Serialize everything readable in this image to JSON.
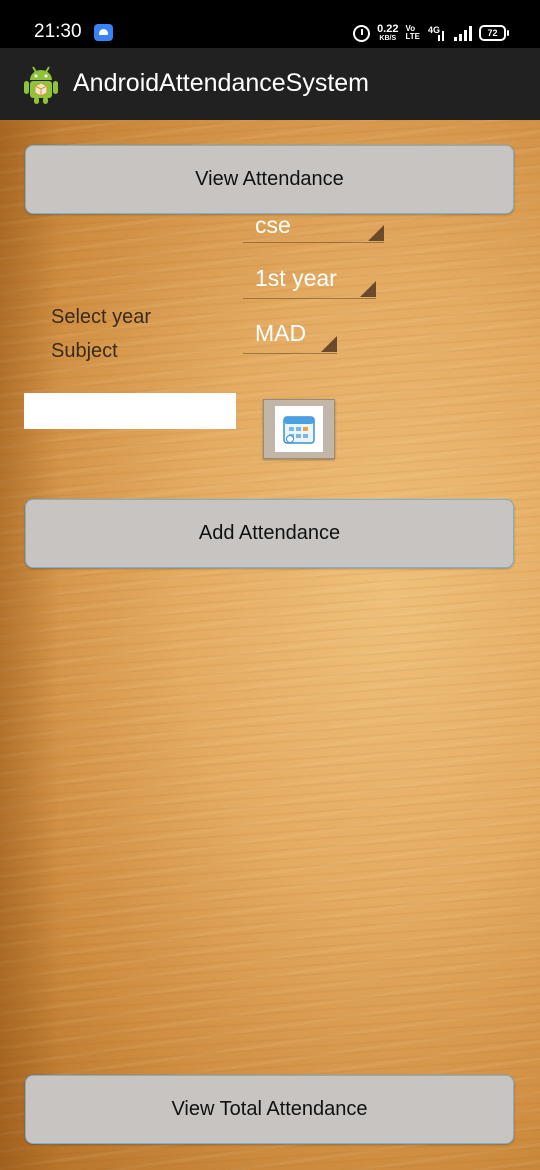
{
  "status_bar": {
    "time": "21:30",
    "net_speed_value": "0.22",
    "net_speed_unit": "KB/S",
    "volte_top": "Vo",
    "volte_bottom": "LTE",
    "network": "4G",
    "battery": "72"
  },
  "action_bar": {
    "title": "AndroidAttendanceSystem",
    "logo_icon": "android-robot-icon"
  },
  "main": {
    "view_attendance_label": "View Attendance",
    "branch_spinner_value": "cse",
    "year_spinner_value": "1st year",
    "subject_spinner_value": "MAD",
    "select_year_label": "Select year",
    "subject_label": "Subject",
    "date_input_value": "",
    "calendar_icon": "calendar-icon",
    "add_attendance_label": "Add Attendance",
    "view_total_attendance_label": "View Total Attendance"
  },
  "colors": {
    "action_bar": "#212121",
    "button_bg": "#c7c4c2",
    "button_border": "#7ab0d6",
    "wood": "#e4ab62"
  }
}
